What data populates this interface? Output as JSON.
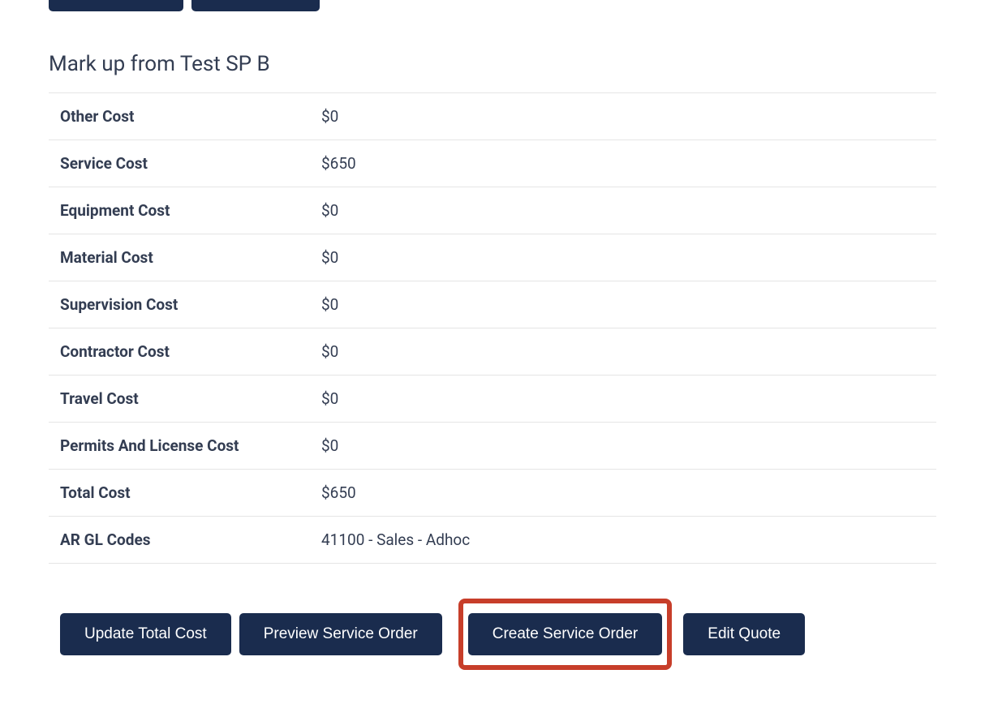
{
  "section_title": "Mark up from Test SP B",
  "costs": [
    {
      "label": "Other Cost",
      "value": "$0"
    },
    {
      "label": "Service Cost",
      "value": "$650"
    },
    {
      "label": "Equipment Cost",
      "value": "$0"
    },
    {
      "label": "Material Cost",
      "value": "$0"
    },
    {
      "label": "Supervision Cost",
      "value": "$0"
    },
    {
      "label": "Contractor Cost",
      "value": "$0"
    },
    {
      "label": "Travel Cost",
      "value": "$0"
    },
    {
      "label": "Permits And License Cost",
      "value": "$0"
    },
    {
      "label": "Total Cost",
      "value": "$650"
    },
    {
      "label": "AR GL Codes",
      "value": "41100 - Sales - Adhoc"
    }
  ],
  "buttons": {
    "update_total_cost": "Update Total Cost",
    "preview_service_order": "Preview Service Order",
    "create_service_order": "Create Service Order",
    "edit_quote": "Edit Quote"
  }
}
